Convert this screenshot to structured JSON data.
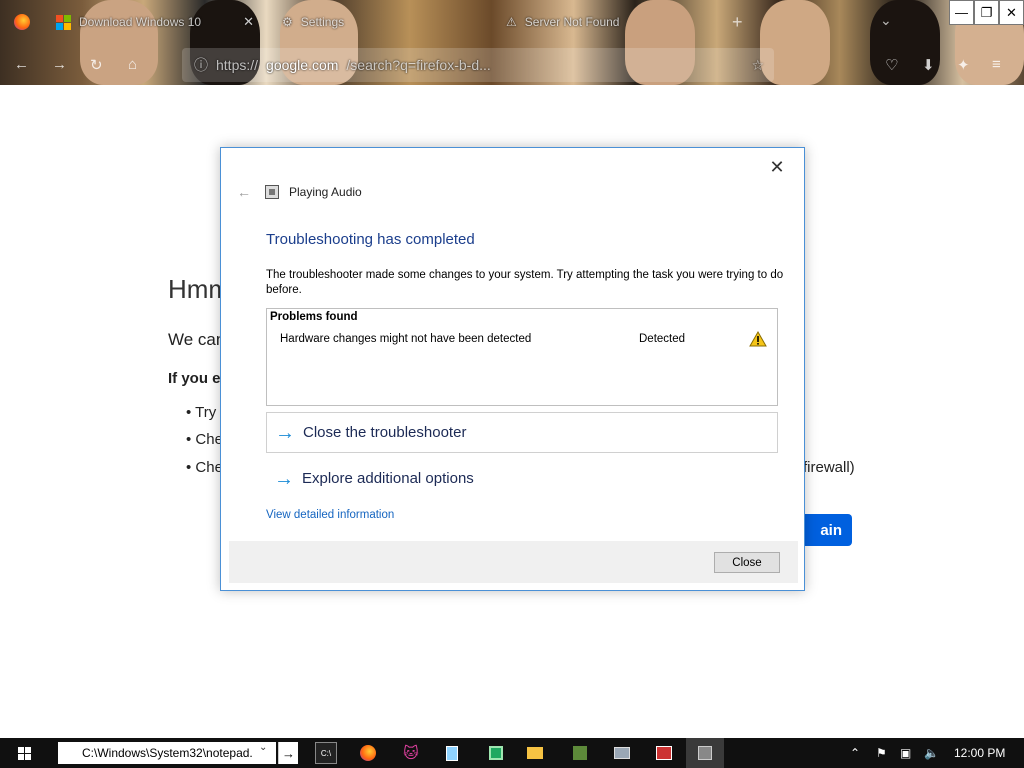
{
  "browser": {
    "tabs": [
      {
        "title": "Download Windows 10"
      },
      {
        "title": "Settings"
      },
      {
        "title": "Server Not Found"
      }
    ],
    "url_prefix": "https://",
    "url_domain": "google.com",
    "url_rest": "/search?q=firefox-b-d..."
  },
  "page": {
    "title": "Hmm",
    "text": "We can",
    "bold": "If you e",
    "bullets": [
      "Try",
      "Che",
      "Che"
    ],
    "tail": "firewall)",
    "button": "ain"
  },
  "dialog": {
    "header_title": "Playing Audio",
    "heading": "Troubleshooting has completed",
    "description": "The troubleshooter made some changes to your system. Try attempting the task you were trying to do before.",
    "problems_title": "Problems found",
    "problems": [
      {
        "description": "Hardware changes might not have been detected",
        "status": "Detected"
      }
    ],
    "links": [
      "Close the troubleshooter",
      "Explore additional options"
    ],
    "detail_link": "View detailed information",
    "close_button": "Close"
  },
  "taskbar": {
    "run_value": "C:\\Windows\\System32\\notepad.",
    "clock": "12:00 PM"
  },
  "colors": {
    "heading": "#1b3e8c",
    "link": "#1565c0",
    "arrow": "#1a8ad6",
    "dialog_border": "#4a90d6",
    "try_again": "#0060df"
  }
}
